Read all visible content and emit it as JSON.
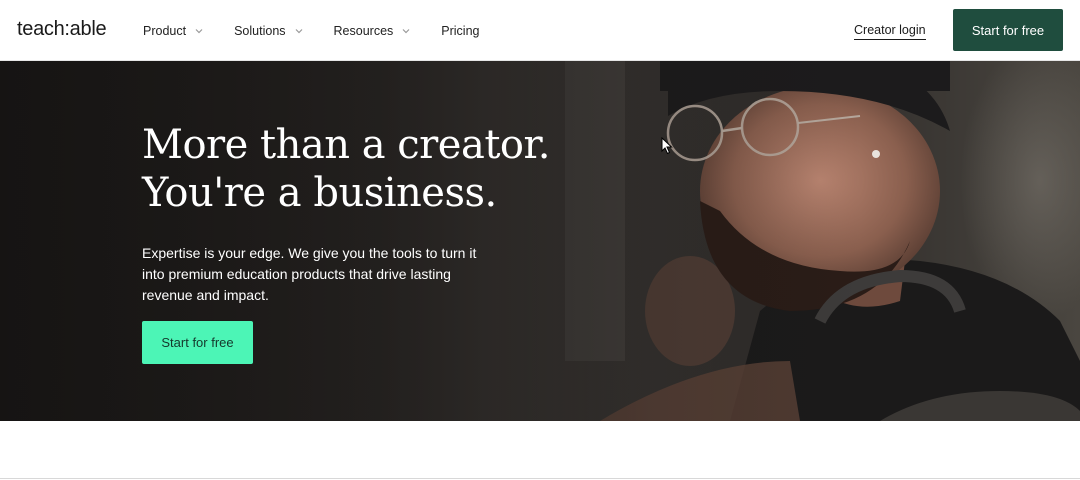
{
  "brand": {
    "logo_text": "teach:able"
  },
  "nav": {
    "items": [
      {
        "label": "Product",
        "has_dropdown": true
      },
      {
        "label": "Solutions",
        "has_dropdown": true
      },
      {
        "label": "Resources",
        "has_dropdown": true
      },
      {
        "label": "Pricing",
        "has_dropdown": false
      }
    ],
    "login_label": "Creator login",
    "cta_label": "Start for free"
  },
  "hero": {
    "title_line1": "More than a creator.",
    "title_line2": "You're a business.",
    "subtitle": "Expertise is your edge. We give you the tools to turn it into premium education products that drive lasting revenue and impact.",
    "cta_label": "Start for free"
  },
  "colors": {
    "header_cta_bg": "#1f4d3e",
    "hero_cta_bg": "#4cf5b6",
    "hero_cta_text": "#15382c"
  },
  "icons": {
    "dropdown": "chevron-down-icon",
    "cursor": "mouse-pointer-icon"
  }
}
